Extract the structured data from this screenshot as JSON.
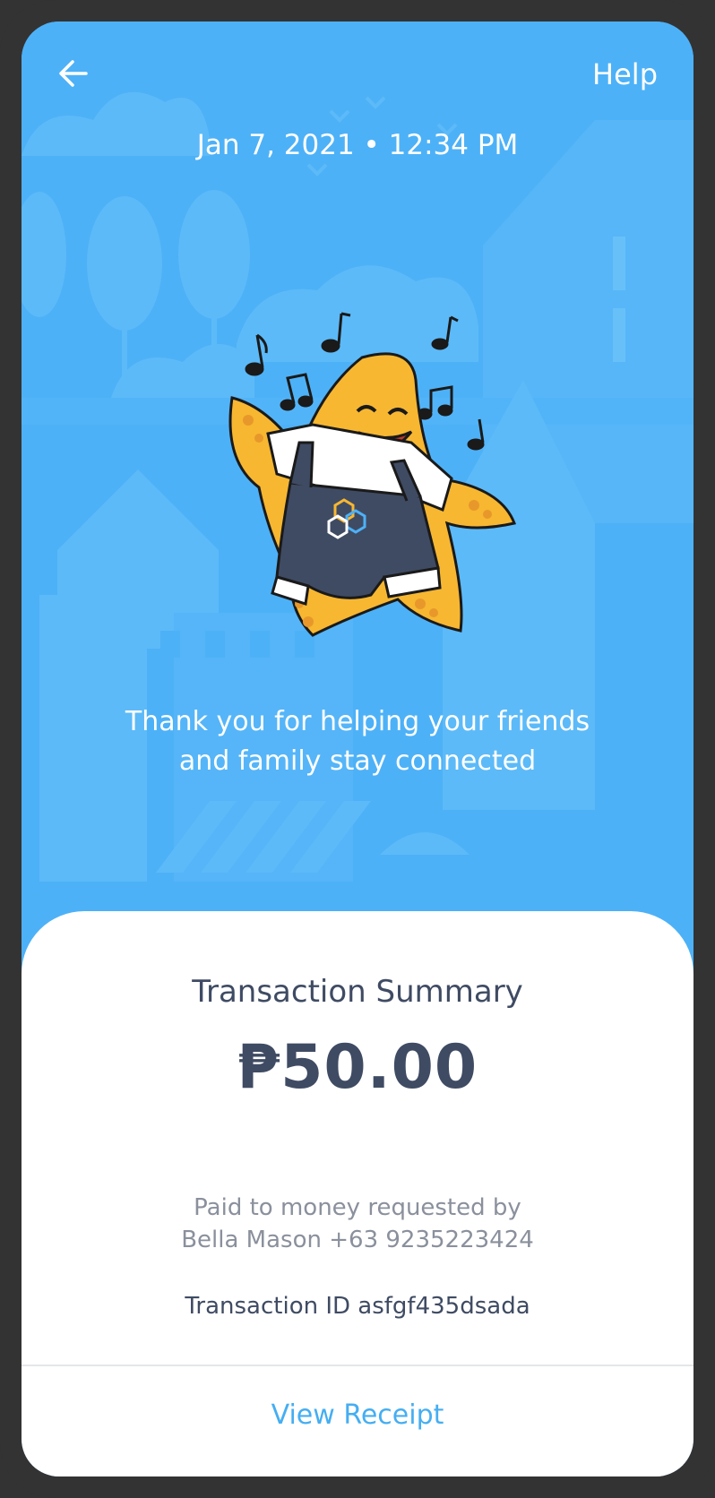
{
  "header": {
    "back_icon": "arrow-left-icon",
    "help_label": "Help"
  },
  "datetime": "Jan 7, 2021 • 12:34 PM",
  "thanks_message": {
    "line1": "Thank you for helping your friends",
    "line2": "and family stay connected"
  },
  "summary": {
    "title": "Transaction Summary",
    "amount": "₱50.00",
    "paid_line1": "Paid to money requested by",
    "paid_line2": "Bella Mason +63 9235223424",
    "transaction_id": "Transaction ID asfgf435dsada"
  },
  "actions": {
    "view_receipt_label": "View Receipt"
  },
  "colors": {
    "sky": "#4db1f7",
    "text_dark": "#3f4b63",
    "text_muted": "#8a909c",
    "link": "#45aef2"
  }
}
